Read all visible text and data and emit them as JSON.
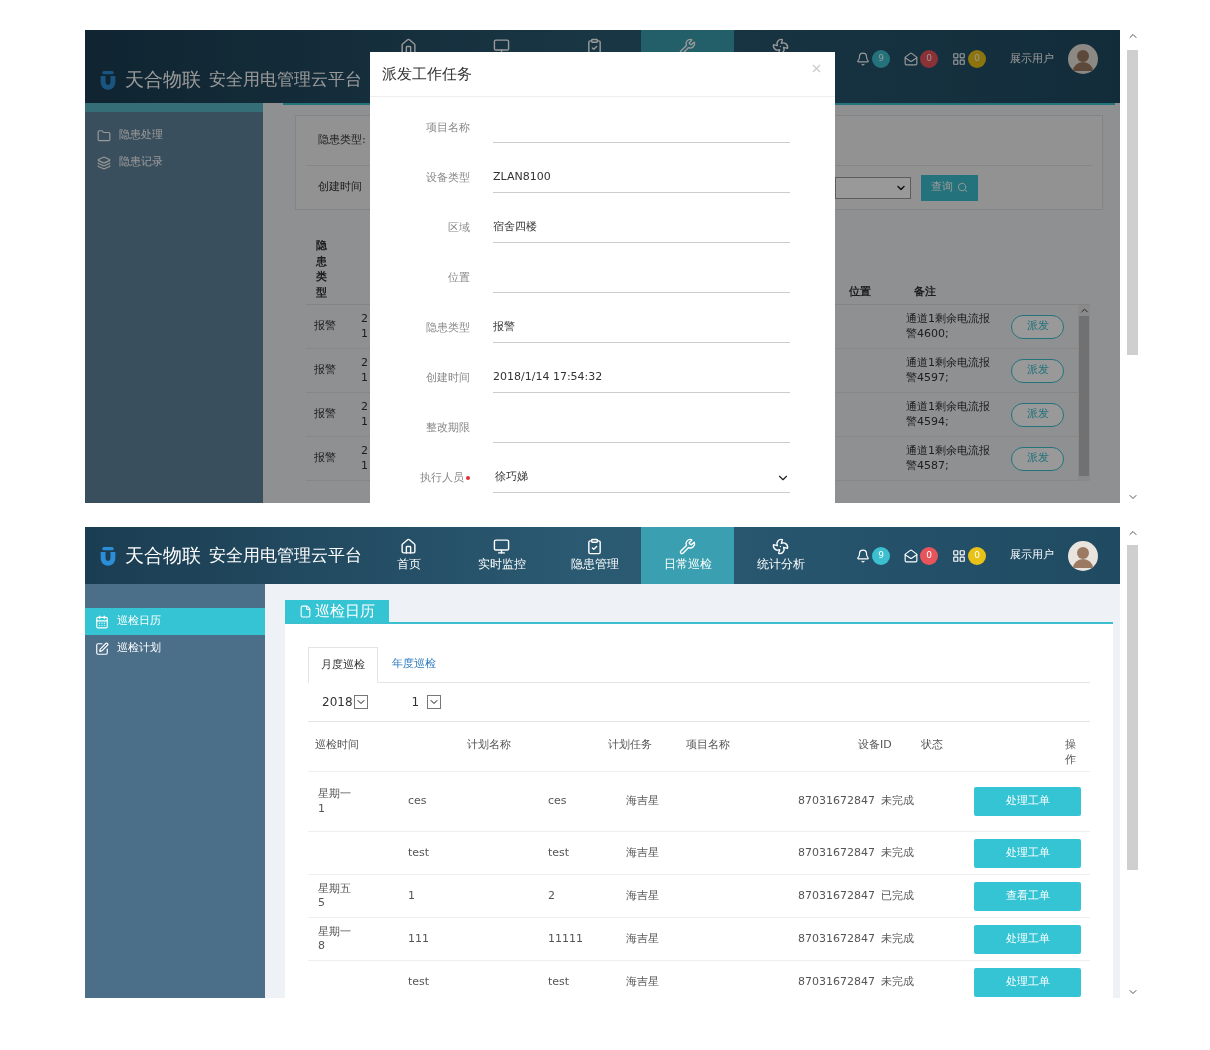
{
  "top_screen": {
    "header": {
      "brand": "天合物联",
      "platform": "安全用电管理云平台",
      "nav": [
        {
          "selected": false
        },
        {
          "selected": false
        },
        {
          "selected": false
        },
        {
          "selected": true
        },
        {
          "selected": false
        }
      ],
      "notifications": [
        {
          "count": "9",
          "color": "#24737c"
        },
        {
          "count": "0",
          "color": "#8b3237"
        },
        {
          "count": "0",
          "color": "#8c740e"
        }
      ],
      "user": "展示用户"
    },
    "sidebar": {
      "items": [
        {
          "label": "隐患处理"
        },
        {
          "label": "隐患记录"
        }
      ]
    },
    "filter": {
      "hazard_type_label": "隐患类型:",
      "created_time_label": "创建时间",
      "query_button": "查询"
    },
    "table": {
      "columns": [
        "隐患类型",
        "位置",
        "备注"
      ],
      "rows": [
        {
          "hazard_type": "报警",
          "column_2": [
            "2",
            "1"
          ],
          "note": "通道1剩余电流报警4600;",
          "action": "派发"
        },
        {
          "hazard_type": "报警",
          "column_2": [
            "2",
            "1"
          ],
          "note": "通道1剩余电流报警4597;",
          "action": "派发"
        },
        {
          "hazard_type": "报警",
          "column_2": [
            "2",
            "1"
          ],
          "note": "通道1剩余电流报警4594;",
          "action": "派发"
        },
        {
          "hazard_type": "报警",
          "column_2": [
            "2",
            "1"
          ],
          "note": "通道1剩余电流报警4587;",
          "action": "派发"
        }
      ]
    },
    "modal": {
      "title": "派发工作任务",
      "fields": [
        {
          "label": "项目名称",
          "kind": "text"
        },
        {
          "label": "设备类型",
          "value": "ZLAN8100",
          "kind": "text"
        },
        {
          "label": "区域",
          "value": "宿舍四楼",
          "kind": "text"
        },
        {
          "label": "位置",
          "kind": "text"
        },
        {
          "label": "隐患类型",
          "value": "报警",
          "kind": "text"
        },
        {
          "label": "创建时间",
          "value": "2018/1/14 17:54:32",
          "kind": "text"
        },
        {
          "label": "整改期限",
          "kind": "text"
        },
        {
          "label": "执行人员",
          "value": "徐巧娣",
          "required": true,
          "kind": "select"
        }
      ]
    }
  },
  "bottom_screen": {
    "header": {
      "brand": "天合物联",
      "platform": "安全用电管理云平台",
      "nav": [
        {
          "label": "首页",
          "selected": false
        },
        {
          "label": "实时监控",
          "selected": false
        },
        {
          "label": "隐患管理",
          "selected": false
        },
        {
          "label": "日常巡检",
          "selected": true
        },
        {
          "label": "统计分析",
          "selected": false
        }
      ],
      "notifications": [
        {
          "count": "9",
          "color": "#3cbfcf"
        },
        {
          "count": "0",
          "color": "#e8545c"
        },
        {
          "count": "0",
          "color": "#e9c217"
        }
      ],
      "user": "展示用户"
    },
    "sidebar": {
      "items": [
        {
          "label": "巡检日历",
          "selected": true
        },
        {
          "label": "巡检计划",
          "selected": false
        }
      ]
    },
    "section_title": "巡检日历",
    "tabs": [
      {
        "label": "月度巡检",
        "selected": true
      },
      {
        "label": "年度巡检",
        "selected": false
      }
    ],
    "filters": {
      "year": "2018",
      "month": "1"
    },
    "table": {
      "columns": [
        "巡检时间",
        "计划名称",
        "计划任务",
        "项目名称",
        "设备ID",
        "状态",
        "操作"
      ],
      "rows": [
        {
          "weekday": "星期一",
          "day": "1",
          "plan_name": "ces",
          "plan_task": "ces",
          "project": "海吉星",
          "device_id": "87031672847",
          "status": "未完成",
          "action": "处理工单"
        },
        {
          "plan_name": "test",
          "plan_task": "test",
          "project": "海吉星",
          "device_id": "87031672847",
          "status": "未完成",
          "action": "处理工单"
        },
        {
          "weekday": "星期五",
          "day": "5",
          "plan_name": "1",
          "plan_task": "2",
          "project": "海吉星",
          "device_id": "87031672847",
          "status": "已完成",
          "action": "查看工单"
        },
        {
          "weekday": "星期一",
          "day": "8",
          "plan_name": "111",
          "plan_task": "11111",
          "project": "海吉星",
          "device_id": "87031672847",
          "status": "未完成",
          "action": "处理工单"
        },
        {
          "plan_name": "test",
          "plan_task": "test",
          "project": "海吉星",
          "device_id": "87031672847",
          "status": "未完成",
          "action": "处理工单"
        }
      ]
    }
  }
}
